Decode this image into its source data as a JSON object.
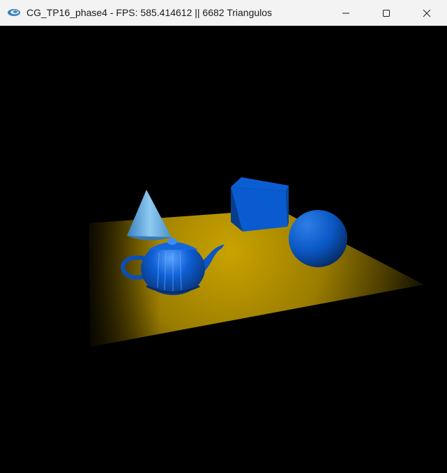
{
  "window": {
    "title": "CG_TP16_phase4 - FPS: 585.414612 || 6682 Triangulos",
    "app_icon": "engine-icon",
    "controls": {
      "minimize_icon": "minimize-icon",
      "maximize_icon": "maximize-icon",
      "close_icon": "close-icon"
    }
  },
  "scene": {
    "background": "#000000",
    "floor_color": "#c9a100",
    "objects": [
      {
        "name": "cone",
        "color": "#6fb7e8"
      },
      {
        "name": "cube",
        "color": "#0a5ed4"
      },
      {
        "name": "teapot",
        "color": "#0a5ed4"
      },
      {
        "name": "sphere",
        "color": "#0a5ed4"
      }
    ]
  }
}
